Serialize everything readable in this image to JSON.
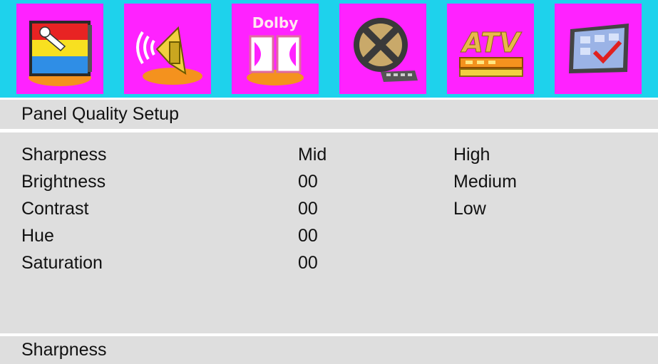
{
  "icons": [
    {
      "name": "picture-setup-icon"
    },
    {
      "name": "audio-speaker-icon"
    },
    {
      "name": "dolby-icon",
      "text": "Dolby"
    },
    {
      "name": "video-film-icon"
    },
    {
      "name": "atv-tuner-icon",
      "text": "ATV"
    },
    {
      "name": "preference-setup-icon"
    }
  ],
  "title": "Panel Quality Setup",
  "menu": [
    {
      "label": "Sharpness",
      "value": "Mid"
    },
    {
      "label": "Brightness",
      "value": "00"
    },
    {
      "label": "Contrast",
      "value": "00"
    },
    {
      "label": "Hue",
      "value": "00"
    },
    {
      "label": "Saturation",
      "value": "00"
    }
  ],
  "options": [
    "High",
    "Medium",
    "Low"
  ],
  "help": "Sharpness",
  "colors": {
    "icon_bar_bg": "#1ed2ec",
    "icon_tile_bg": "#ff22ff",
    "panel_bg": "#dedede",
    "text": "#111111"
  }
}
